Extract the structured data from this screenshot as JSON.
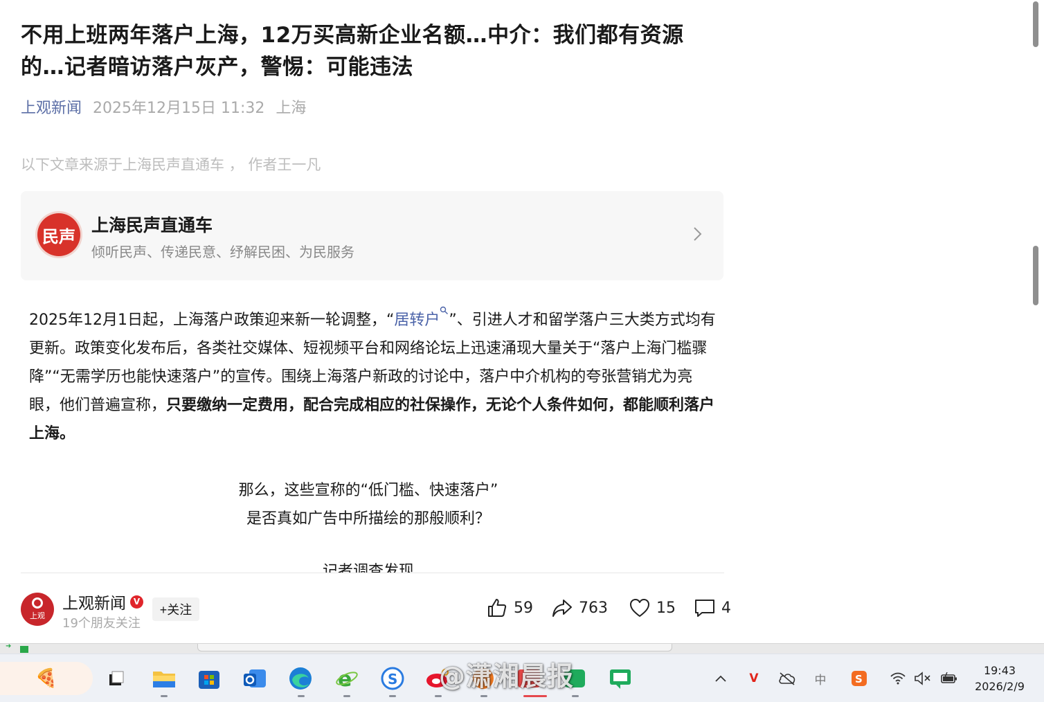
{
  "article": {
    "title": "不用上班两年落户上海，12万买高新企业名额…中介：我们都有资源的…记者暗访落户灰产，警惕：可能违法",
    "source": "上观新闻",
    "datetime": "2025年12月15日 11:32",
    "location": "上海",
    "from_note": "以下文章来源于上海民声直通车 ， 作者王一凡"
  },
  "account_card": {
    "logo_text": "民声",
    "name": "上海民声直通车",
    "description": "倾听民声、传递民意、纾解民困、为民服务"
  },
  "body": {
    "p1_part1": "2025年12月1日起，上海落户政策迎来新一轮调整，“",
    "p1_link": "居转户",
    "p1_part2": "”、引进人才和留学落户三大类方式均有更新。政策变化发布后，各类社交媒体、短视频平台和网络论坛上迅速涌现大量关于“落户上海门槛骤降”“无需学历也能快速落户”的宣传。围绕上海落户新政的讨论中，落户中介机构的夸张营销尤为亮眼，他们普遍宣称，",
    "p1_bold": "只要缴纳一定费用，配合完成相应的社保操作，无论个人条件如何，都能顺利落户上海。",
    "center_line1": "那么，这些宣称的“低门槛、快速落户”",
    "center_line2": "是否真如广告中所描绘的那般顺利？",
    "cut_line": "记者调查发现"
  },
  "footer": {
    "avatar_text": "上观",
    "name": "上观新闻",
    "verified_mark": "V",
    "followers_note": "19个朋友关注",
    "follow_label": "+关注",
    "likes": "59",
    "shares": "763",
    "favorites": "15",
    "comments": "4"
  },
  "taskbar": {
    "watermark": "@潇湘晨报",
    "tray_v": "V",
    "tray_ime": "中",
    "tray_s": "S",
    "time": "19:43",
    "date": "2026/2/9"
  },
  "colors": {
    "link": "#4a62a8",
    "meta_source": "#5b6ea6",
    "verified": "#e0252b",
    "brand_red": "#d8322a"
  }
}
